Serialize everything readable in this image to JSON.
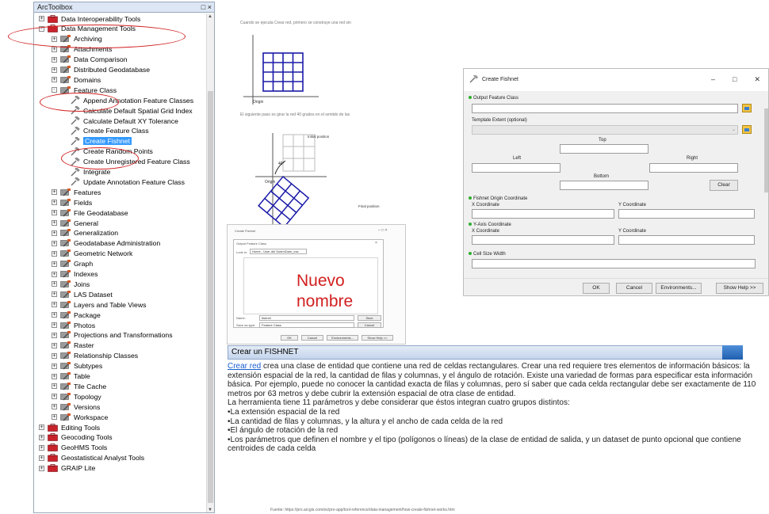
{
  "arctoolbox": {
    "title": "ArcToolbox",
    "items": [
      {
        "label": "Data Interoperability Tools",
        "level": 0,
        "kind": "toolbox",
        "expander": "+"
      },
      {
        "label": "Data Management Tools",
        "level": 0,
        "kind": "toolbox",
        "expander": "-"
      },
      {
        "label": "Archiving",
        "level": 1,
        "kind": "toolset",
        "expander": "+"
      },
      {
        "label": "Attachments",
        "level": 1,
        "kind": "toolset",
        "expander": "+"
      },
      {
        "label": "Data Comparison",
        "level": 1,
        "kind": "toolset",
        "expander": "+"
      },
      {
        "label": "Distributed Geodatabase",
        "level": 1,
        "kind": "toolset",
        "expander": "+"
      },
      {
        "label": "Domains",
        "level": 1,
        "kind": "toolset",
        "expander": "+"
      },
      {
        "label": "Feature Class",
        "level": 1,
        "kind": "toolset",
        "expander": "-"
      },
      {
        "label": "Append Annotation Feature Classes",
        "level": 2,
        "kind": "tool"
      },
      {
        "label": "Calculate Default Spatial Grid Index",
        "level": 2,
        "kind": "tool"
      },
      {
        "label": "Calculate Default XY Tolerance",
        "level": 2,
        "kind": "tool"
      },
      {
        "label": "Create Feature Class",
        "level": 2,
        "kind": "tool"
      },
      {
        "label": "Create Fishnet",
        "level": 2,
        "kind": "tool",
        "selected": true
      },
      {
        "label": "Create Random Points",
        "level": 2,
        "kind": "tool"
      },
      {
        "label": "Create Unregistered Feature Class",
        "level": 2,
        "kind": "tool"
      },
      {
        "label": "Integrate",
        "level": 2,
        "kind": "tool"
      },
      {
        "label": "Update Annotation Feature Class",
        "level": 2,
        "kind": "tool"
      },
      {
        "label": "Features",
        "level": 1,
        "kind": "toolset",
        "expander": "+"
      },
      {
        "label": "Fields",
        "level": 1,
        "kind": "toolset",
        "expander": "+"
      },
      {
        "label": "File Geodatabase",
        "level": 1,
        "kind": "toolset",
        "expander": "+"
      },
      {
        "label": "General",
        "level": 1,
        "kind": "toolset",
        "expander": "+"
      },
      {
        "label": "Generalization",
        "level": 1,
        "kind": "toolset",
        "expander": "+"
      },
      {
        "label": "Geodatabase Administration",
        "level": 1,
        "kind": "toolset",
        "expander": "+"
      },
      {
        "label": "Geometric Network",
        "level": 1,
        "kind": "toolset",
        "expander": "+"
      },
      {
        "label": "Graph",
        "level": 1,
        "kind": "toolset",
        "expander": "+"
      },
      {
        "label": "Indexes",
        "level": 1,
        "kind": "toolset",
        "expander": "+"
      },
      {
        "label": "Joins",
        "level": 1,
        "kind": "toolset",
        "expander": "+"
      },
      {
        "label": "LAS Dataset",
        "level": 1,
        "kind": "toolset",
        "expander": "+"
      },
      {
        "label": "Layers and Table Views",
        "level": 1,
        "kind": "toolset",
        "expander": "+"
      },
      {
        "label": "Package",
        "level": 1,
        "kind": "toolset",
        "expander": "+"
      },
      {
        "label": "Photos",
        "level": 1,
        "kind": "toolset",
        "expander": "+"
      },
      {
        "label": "Projections and Transformations",
        "level": 1,
        "kind": "toolset",
        "expander": "+"
      },
      {
        "label": "Raster",
        "level": 1,
        "kind": "toolset",
        "expander": "+"
      },
      {
        "label": "Relationship Classes",
        "level": 1,
        "kind": "toolset",
        "expander": "+"
      },
      {
        "label": "Subtypes",
        "level": 1,
        "kind": "toolset",
        "expander": "+"
      },
      {
        "label": "Table",
        "level": 1,
        "kind": "toolset",
        "expander": "+"
      },
      {
        "label": "Tile Cache",
        "level": 1,
        "kind": "toolset",
        "expander": "+"
      },
      {
        "label": "Topology",
        "level": 1,
        "kind": "toolset",
        "expander": "+"
      },
      {
        "label": "Versions",
        "level": 1,
        "kind": "toolset",
        "expander": "+"
      },
      {
        "label": "Workspace",
        "level": 1,
        "kind": "toolset",
        "expander": "+"
      },
      {
        "label": "Editing Tools",
        "level": 0,
        "kind": "toolbox",
        "expander": "+"
      },
      {
        "label": "Geocoding Tools",
        "level": 0,
        "kind": "toolbox",
        "expander": "+"
      },
      {
        "label": "GeoHMS Tools",
        "level": 0,
        "kind": "toolbox",
        "expander": "+"
      },
      {
        "label": "Geostatistical Analyst Tools",
        "level": 0,
        "kind": "toolbox",
        "expander": "+"
      },
      {
        "label": "GRAIP Lite",
        "level": 0,
        "kind": "toolbox",
        "expander": "+"
      }
    ]
  },
  "figures": {
    "caption1": "Cuando se ejecuta Crear red, primero se construye una red sin",
    "caption2": "El siguiente paso es girar la red 40 grados en el sentido de las",
    "origin": "Origin",
    "origin2": "Origin",
    "initial_position": "Initial position",
    "final_position": "Final position",
    "angle": "40°"
  },
  "save_dialog": {
    "title": "Create Fishnet",
    "inner_title": "Output Feature Class",
    "look_in_label": "Look in:",
    "look_in_value": "Home - User del Sudm\\Dam_low",
    "name_label": "Name:",
    "name_value": "fishnet",
    "save_as_label": "Save as type:",
    "save_as_value": "Feature Class",
    "save_btn": "Save",
    "cancel_btn": "Cancel",
    "ok_btn": "OK",
    "cancel2_btn": "Cancel",
    "env_btn": "Environments...",
    "help_btn": "Show Help >>",
    "overlay": "Nuevo nombre"
  },
  "fishnet_dialog": {
    "title": "Create Fishnet",
    "output_feature_class": "Output Feature Class",
    "template_extent": "Template Extent (optional)",
    "top": "Top",
    "left": "Left",
    "right": "Right",
    "bottom": "Bottom",
    "clear": "Clear",
    "origin_coord": "Fishnet Origin Coordinate",
    "x_coord": "X Coordinate",
    "y_coord": "Y Coordinate",
    "yaxis_coord": "Y-Axis Coordinate",
    "x_coord2": "X Coordinate",
    "y_coord2": "Y Coordinate",
    "cell_size_width": "Cell Size Width",
    "ok": "OK",
    "cancel": "Cancel",
    "environments": "Environments...",
    "show_help": "Show Help >>",
    "minimize": "–",
    "maximize": "□",
    "close": "✕"
  },
  "section": {
    "header": "Crear un FISHNET",
    "link_text": "Crear red",
    "paragraph1_rest": " crea una clase de entidad que contiene una red de celdas rectangulares. Crear una red requiere tres elementos de información básicos: la extensión espacial de la red, la cantidad de filas y columnas, y el ángulo de rotación. Existe una variedad de formas para especificar esta información básica. Por ejemplo, puede no conocer la cantidad exacta de filas y columnas, pero sí saber que cada celda rectangular debe ser exactamente de 110 metros por 63 metros y debe cubrir la extensión espacial de otra clase de entidad.",
    "paragraph2": "La herramienta tiene 11 parámetros y debe considerar que éstos integran cuatro grupos distintos:",
    "bullets": [
      "•La extensión espacial de la red",
      "•La cantidad de filas y columnas, y la altura y el ancho de cada celda de la red",
      "•El ángulo de rotación de la red",
      "•Los parámetros que definen el nombre y el tipo (polígonos o líneas) de la clase de entidad de salida, y un dataset de punto opcional que contiene centroides de cada celda"
    ],
    "source": "Fuente: https://pro.arcgis.com/es/pro-app/tool-reference/data-management/how-create-fishnet-works.htm"
  },
  "colors": {
    "highlight": "#d21f1f",
    "selection": "#3399ff",
    "grid": "#1a1aa8"
  }
}
